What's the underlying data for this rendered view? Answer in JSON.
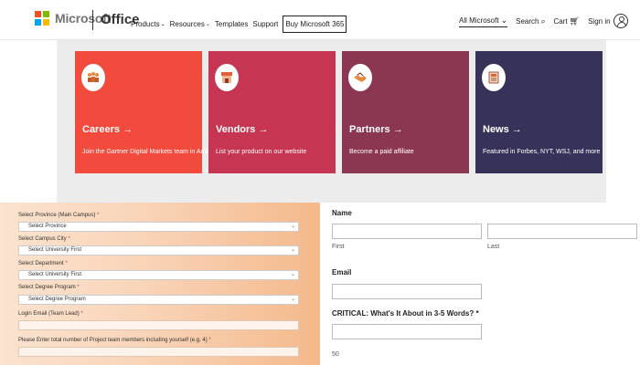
{
  "header": {
    "brand": "Microsoft",
    "product": "Office",
    "nav": [
      {
        "label": "Products",
        "has_dropdown": true
      },
      {
        "label": "Resources",
        "has_dropdown": true
      },
      {
        "label": "Templates",
        "has_dropdown": false
      },
      {
        "label": "Support",
        "has_dropdown": false
      }
    ],
    "buy_label": "Buy Microsoft 365",
    "all_microsoft_label": "All Microsoft",
    "search_label": "Search",
    "cart_label": "Cart",
    "sign_in_label": "Sign in"
  },
  "cards": [
    {
      "title": "Careers →",
      "desc": "Join the Gartner Digital Markets team in Austin",
      "icon": "people-icon",
      "color": "#f24a3d"
    },
    {
      "title": "Vendors →",
      "desc": "List your product on our website",
      "icon": "storefront-icon",
      "color": "#c63551"
    },
    {
      "title": "Partners →",
      "desc": "Become a paid affiliate",
      "icon": "handshake-icon",
      "color": "#8c3752"
    },
    {
      "title": "News →",
      "desc": "Featured in Forbes, NYT, WSJ, and more",
      "icon": "newspaper-icon",
      "color": "#37325a"
    }
  ],
  "left_form": {
    "province_label": "Select Province (Main Campus)",
    "province_value": "Select Province",
    "campus_city_label": "Select Campus City",
    "campus_city_value": "Select University First",
    "department_label": "Select Department",
    "department_value": "Select University First",
    "degree_label": "Select Degree Program",
    "degree_value": "Select Degree Program",
    "email_label": "Login Email (Team Lead)",
    "email_value": "",
    "members_label": "Please Enter total number of Project team members including yourself (e.g. 4)",
    "members_value": "",
    "required_marker": "*"
  },
  "right_form": {
    "name_label": "Name",
    "first_label": "First",
    "last_label": "Last",
    "email_label": "Email",
    "critical_label": "CRITICAL: What's It About in 3-5 Words? *",
    "char_count": "50"
  }
}
